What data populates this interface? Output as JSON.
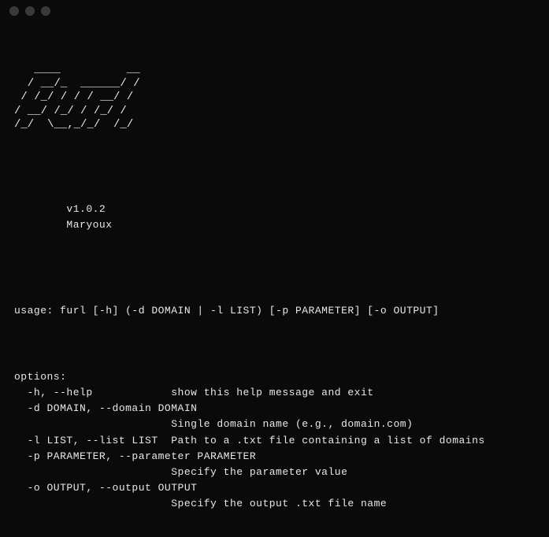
{
  "titlebar": {
    "buttons": [
      "close",
      "minimize",
      "zoom"
    ]
  },
  "banner": {
    "ascii": "   ____          __\n  / __/_  ______/ /\n / /_/ / / / __/ / \n/ __/ /_/ / /_/ /  \n/_/  \\__,_/_/  /_/  "
  },
  "meta": {
    "version": "v1.0.2",
    "author": "Maryoux"
  },
  "usage": {
    "line": "usage: furl [-h] (-d DOMAIN | -l LIST) [-p PARAMETER] [-o OUTPUT]"
  },
  "options": {
    "header": "options:",
    "items": [
      {
        "flag": "  -h, --help            ",
        "desc": "show this help message and exit"
      },
      {
        "flag": "  -d DOMAIN, --domain DOMAIN",
        "desc": ""
      },
      {
        "flag": "                        ",
        "desc": "Single domain name (e.g., domain.com)"
      },
      {
        "flag": "  -l LIST, --list LIST  ",
        "desc": "Path to a .txt file containing a list of domains"
      },
      {
        "flag": "  -p PARAMETER, --parameter PARAMETER",
        "desc": ""
      },
      {
        "flag": "                        ",
        "desc": "Specify the parameter value"
      },
      {
        "flag": "  -o OUTPUT, --output OUTPUT",
        "desc": ""
      },
      {
        "flag": "                        ",
        "desc": "Specify the output .txt file name"
      }
    ]
  }
}
